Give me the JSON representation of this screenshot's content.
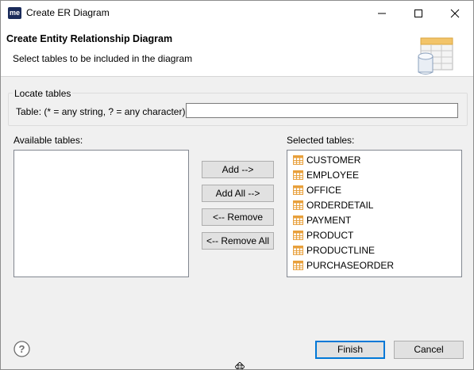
{
  "window": {
    "app_icon_text": "me",
    "title": "Create ER Diagram"
  },
  "header": {
    "title": "Create Entity Relationship Diagram",
    "description": "Select tables to be included in the diagram"
  },
  "locate": {
    "legend": "Locate tables",
    "filter_label": "Table: (* = any string, ? = any character)",
    "filter_value": ""
  },
  "available": {
    "label": "Available tables:",
    "items": []
  },
  "selected": {
    "label": "Selected tables:",
    "items": [
      "CUSTOMER",
      "EMPLOYEE",
      "OFFICE",
      "ORDERDETAIL",
      "PAYMENT",
      "PRODUCT",
      "PRODUCTLINE",
      "PURCHASEORDER"
    ]
  },
  "actions": {
    "add": "Add -->",
    "add_all": "Add All -->",
    "remove": "<-- Remove",
    "remove_all": "<-- Remove All"
  },
  "footer": {
    "finish": "Finish",
    "cancel": "Cancel"
  },
  "icons": {
    "help": "help-icon",
    "table": "table-icon",
    "header": "database-table-icon"
  },
  "colors": {
    "accent": "#0078d7",
    "table_icon": "#e8a03c"
  }
}
